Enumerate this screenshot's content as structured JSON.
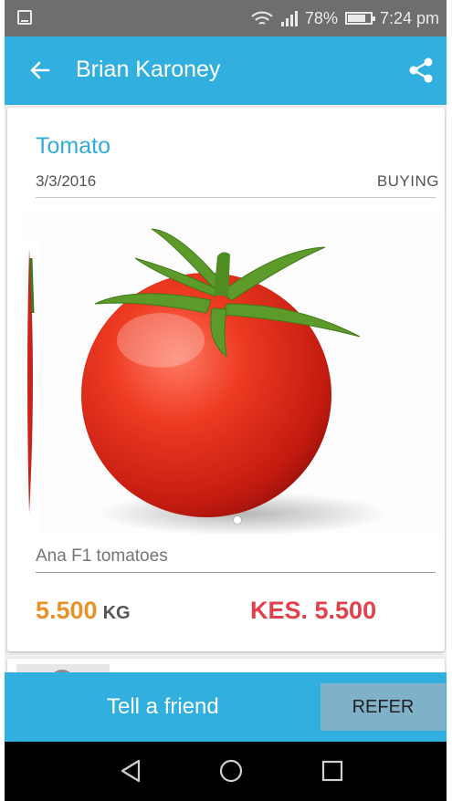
{
  "status_bar": {
    "battery_text": "78%",
    "time": "7:24 pm",
    "battery_level": 0.78
  },
  "app_bar": {
    "title": "Brian Karoney",
    "back_icon": "arrow-back-icon",
    "share_icon": "share-icon"
  },
  "listing": {
    "name": "Tomato",
    "date": "3/3/2016",
    "status": "BUYING",
    "description": "Ana F1 tomatoes",
    "quantity": "5.500",
    "unit": "KG",
    "price": "KES. 5.500",
    "colors": {
      "name": "#32acd9",
      "quantity": "#e8922a",
      "price": "#e0414a"
    }
  },
  "refer": {
    "label": "Tell a friend",
    "button": "REFER"
  },
  "nav": {
    "back": "nav-back-icon",
    "home": "nav-home-icon",
    "recents": "nav-recents-icon"
  },
  "colors": {
    "primary": "#31b0df"
  }
}
